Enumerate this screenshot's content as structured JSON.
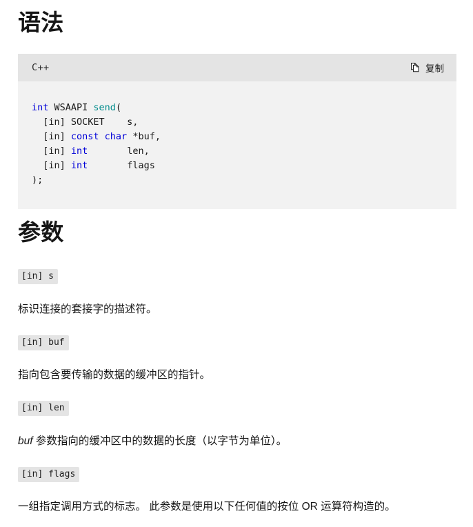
{
  "sections": {
    "syntax": {
      "heading": "语法"
    },
    "parameters": {
      "heading": "参数"
    }
  },
  "code_block": {
    "language_label": "C++",
    "copy_label": "复制",
    "copy_icon": "copy-pages-icon",
    "lines": [
      {
        "tokens": [
          {
            "t": "int",
            "c": "kw"
          },
          {
            "t": " WSAAPI ",
            "c": "pln"
          },
          {
            "t": "send",
            "c": "fn"
          },
          {
            "t": "(",
            "c": "pln"
          }
        ]
      },
      {
        "tokens": [
          {
            "t": "  [in] SOCKET    s,",
            "c": "pln"
          }
        ]
      },
      {
        "tokens": [
          {
            "t": "  [in] ",
            "c": "pln"
          },
          {
            "t": "const char",
            "c": "kw"
          },
          {
            "t": " *buf,",
            "c": "pln"
          }
        ]
      },
      {
        "tokens": [
          {
            "t": "  [in] ",
            "c": "pln"
          },
          {
            "t": "int",
            "c": "kw"
          },
          {
            "t": "       len,",
            "c": "pln"
          }
        ]
      },
      {
        "tokens": [
          {
            "t": "  [in] ",
            "c": "pln"
          },
          {
            "t": "int",
            "c": "kw"
          },
          {
            "t": "       flags",
            "c": "pln"
          }
        ]
      },
      {
        "tokens": [
          {
            "t": ");",
            "c": "pln"
          }
        ]
      }
    ],
    "plain_text": "int WSAAPI send(\n  [in] SOCKET    s,\n  [in] const char *buf,\n  [in] int       len,\n  [in] int       flags\n);"
  },
  "parameters": [
    {
      "chip": "[in] s",
      "description_plain": "标识连接的套接字的描述符。",
      "description_parts": [
        {
          "text": "标识连接的套接字的描述符。",
          "italic": false
        }
      ]
    },
    {
      "chip": "[in] buf",
      "description_plain": "指向包含要传输的数据的缓冲区的指针。",
      "description_parts": [
        {
          "text": "指向包含要传输的数据的缓冲区的指针。",
          "italic": false
        }
      ]
    },
    {
      "chip": "[in] len",
      "description_plain": "buf 参数指向的缓冲区中的数据的长度（以字节为单位）。",
      "description_parts": [
        {
          "text": "buf",
          "italic": true
        },
        {
          "text": " 参数指向的缓冲区中的数据的长度（以字节为单位）。",
          "italic": false
        }
      ]
    },
    {
      "chip": "[in] flags",
      "description_plain": "一组指定调用方式的标志。 此参数是使用以下任何值的按位 OR 运算符构造的。",
      "description_parts": [
        {
          "text": "一组指定调用方式的标志。 此参数是使用以下任何值的按位 OR 运算符构造的。",
          "italic": false
        }
      ]
    }
  ],
  "colors": {
    "page_background": "#ffffff",
    "text": "#171717",
    "code_background": "#f2f2f2",
    "code_header_background": "#e4e4e4",
    "inline_code_background": "#e4e4e4",
    "keyword": "#0000d8",
    "function_name": "#018c8c",
    "code_text": "#1a1a1a"
  }
}
